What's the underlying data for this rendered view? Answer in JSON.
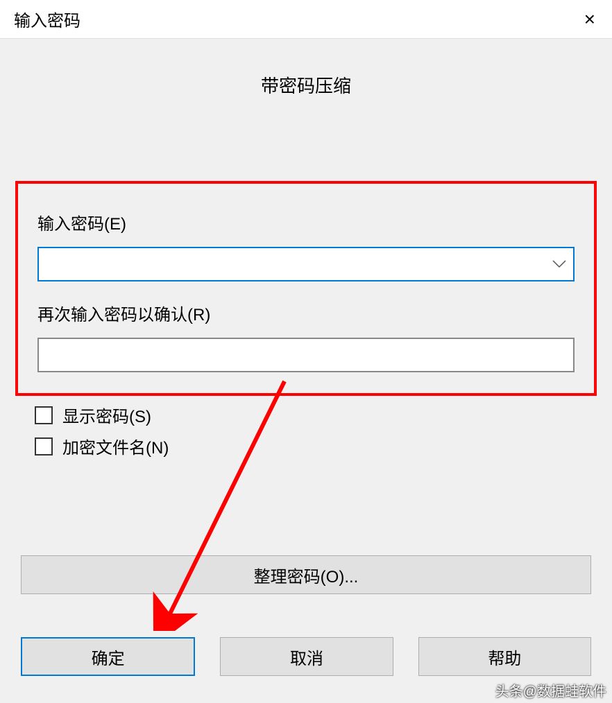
{
  "titlebar": {
    "title": "输入密码",
    "close_icon": "×"
  },
  "heading": "带密码压缩",
  "fields": {
    "password_label": "输入密码(E)",
    "confirm_label": "再次输入密码以确认(R)",
    "password_value": "",
    "confirm_value": ""
  },
  "checkboxes": {
    "show_password": "显示密码(S)",
    "encrypt_filenames": "加密文件名(N)"
  },
  "buttons": {
    "organize": "整理密码(O)...",
    "ok": "确定",
    "cancel": "取消",
    "help": "帮助"
  },
  "watermark": "头条@数据蛙软件"
}
